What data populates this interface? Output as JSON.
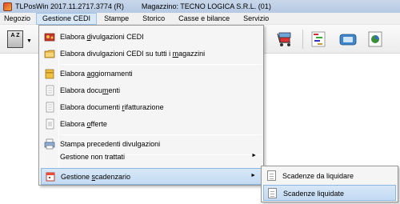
{
  "window": {
    "app_title": "TLPosWin 2017.11.2717.3774 (R)",
    "store_label": "Magazzino: TECNO LOGICA S.R.L. (01)"
  },
  "menubar": {
    "items": [
      "Negozio",
      "Gestione CEDI",
      "Stampe",
      "Storico",
      "Casse e bilance",
      "Servizio"
    ],
    "active_index": 1
  },
  "toolbar": {
    "az_label": "A Z"
  },
  "menu": {
    "items": [
      {
        "label_pre": "Elabora ",
        "label_u": "d",
        "label_post": "ivulgazioni CEDI",
        "icon": "gears-icon"
      },
      {
        "label_pre": "Elabora divulgazioni CEDI su tutti i ",
        "label_u": "m",
        "label_post": "agazzini",
        "icon": "folder-icon"
      },
      {
        "label_pre": "Elabora ",
        "label_u": "a",
        "label_post": "ggiornamenti",
        "icon": "package-icon"
      },
      {
        "label_pre": "Elabora docu",
        "label_u": "m",
        "label_post": "enti",
        "icon": "document-icon"
      },
      {
        "label_pre": "Elabora documenti ",
        "label_u": "r",
        "label_post": "ifatturazione",
        "icon": "document-icon"
      },
      {
        "label_pre": "Elabora ",
        "label_u": "o",
        "label_post": "fferte",
        "icon": "offer-icon"
      },
      {
        "label_pre": "Stampa precedenti divulgazioni",
        "label_u": "",
        "label_post": "",
        "icon": "printer-icon"
      },
      {
        "label_pre": "Gestione non trattati",
        "label_u": "",
        "label_post": "",
        "icon": "none"
      },
      {
        "label_pre": "Gestione ",
        "label_u": "s",
        "label_post": "cadenzario",
        "icon": "calendar-icon"
      }
    ],
    "submenu_arrow": "►"
  },
  "submenu": {
    "items": [
      {
        "label": "Scadenze da liquidare",
        "icon": "document-icon"
      },
      {
        "label": "Scadenze liquidate",
        "icon": "document-icon"
      }
    ]
  },
  "colors": {
    "highlight": "#c3dbf3",
    "highlight_border": "#8bb7e3",
    "menu_bg": "#f5f5f5"
  }
}
